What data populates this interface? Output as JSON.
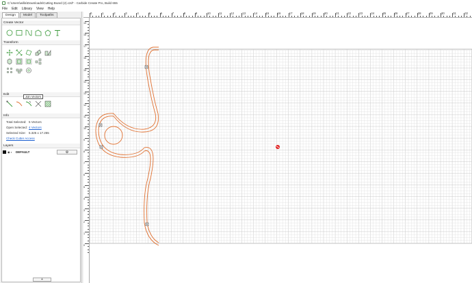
{
  "window": {
    "title": "C:\\Users\\willa\\Downloads\\Cutting Board (2).c2d* - Carbide Create Pro, Build 655"
  },
  "menu": {
    "items": [
      {
        "label": "File"
      },
      {
        "label": "Edit"
      },
      {
        "label": "Library"
      },
      {
        "label": "View"
      },
      {
        "label": "Help"
      }
    ]
  },
  "tabs": [
    {
      "label": "Design",
      "active": true
    },
    {
      "label": "Model",
      "active": false
    },
    {
      "label": "Toolpaths",
      "active": false
    }
  ],
  "sections": {
    "create_vector": "Create Vector",
    "transform": "Transform",
    "edit": "Edit",
    "info": "Info",
    "layers": "Layers"
  },
  "create_vector_icons": [
    "circle-icon",
    "rectangle-icon",
    "curve-icon",
    "polygon-icon",
    "pentagon-icon",
    "text-icon"
  ],
  "transform_icons": [
    "move-icon",
    "scale-icon",
    "rotate-icon",
    "align-icon",
    "flip-icon",
    "offset-icon",
    "group-icon",
    "ungroup-icon",
    "array-icon",
    "circular-array-icon",
    "mirror-icon",
    "weld-icon"
  ],
  "edit_icons": [
    "node-edit-icon",
    "join-vectors-icon",
    "trim-icon",
    "boolean-icon",
    "fill-icon"
  ],
  "tooltip": "Join Vectors",
  "info": {
    "total_selected_label": "Total Selected:",
    "total_selected_value": "5 Vectors",
    "open_selected_label": "Open Selected:",
    "open_selected_value": "4 Vectors",
    "selected_size_label": "Selected Size:",
    "selected_size_value": "5.325 x 17.255",
    "check_cutter_access": "Check Cutter Access"
  },
  "layers": {
    "items": [
      {
        "name": "DEFAULT",
        "color": "#111111"
      }
    ],
    "gear": "⚙",
    "add": "+"
  },
  "ruler": {
    "h_labels": [
      "0",
      "1",
      "2",
      "3",
      "4",
      "5",
      "6",
      "7",
      "8",
      "9",
      "10",
      "11",
      "12",
      "13",
      "14",
      "15",
      "16",
      "17",
      "18",
      "19",
      "20",
      "21",
      "22",
      "23",
      "24",
      "25",
      "26",
      "27",
      "28",
      "29",
      "30",
      "31",
      "32"
    ],
    "v_labels": [
      "21",
      "20",
      "19",
      "18",
      "17",
      "16",
      "15",
      "14",
      "13",
      "12",
      "11",
      "10",
      "9",
      "8",
      "7",
      "6",
      "5",
      "4",
      "3",
      "2",
      "1",
      "0"
    ]
  },
  "colors": {
    "vector_stroke": "#e07030",
    "grid_minor": "#e4e4e4",
    "grid_major": "#c8c8c8",
    "icon_green": "#3c9a3c",
    "origin_marker": "#e02020"
  }
}
